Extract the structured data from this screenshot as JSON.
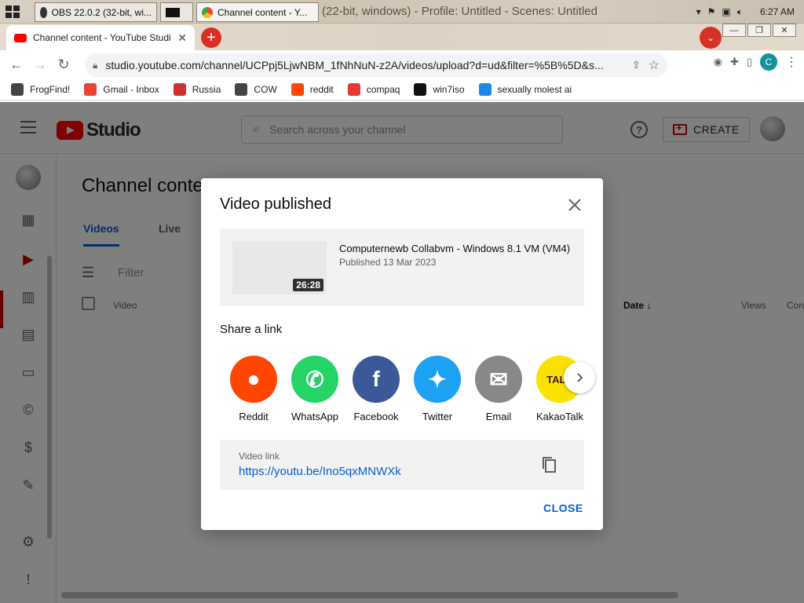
{
  "taskbar": {
    "window_title": "Channel content - YouTube Studio - Google Chrome",
    "obs_title": "OBS 22.0.2 (32-bit, windows) - Profile: Untitled - Scenes: Untitled",
    "obs_button": "OBS 22.0.2 (32-bit, wi...",
    "cmd_button": "",
    "chrome_button": "Channel content - Y...",
    "obs_title_behind": "(22-bit, windows) - Profile: Untitled - Scenes: Untitled",
    "clock": "6:27 AM"
  },
  "chrome": {
    "tab_title": "Channel content - YouTube Studi",
    "url": "studio.youtube.com/channel/UCPpj5LjwNBM_1fNhNuN-z2A/videos/upload?d=ud&filter=%5B%5D&s...",
    "profile_letter": "C"
  },
  "bookmarks": [
    {
      "label": "FrogFind!",
      "color": "#444"
    },
    {
      "label": "Gmail - Inbox",
      "color": "#ea4335"
    },
    {
      "label": "Russia",
      "color": "#d32f2f"
    },
    {
      "label": "COW",
      "color": "#444"
    },
    {
      "label": "reddit",
      "color": "#ff4500"
    },
    {
      "label": "compaq",
      "color": "#e53935"
    },
    {
      "label": "win7iso",
      "color": "#111"
    },
    {
      "label": "sexually molest ai",
      "color": "#1e88e5"
    }
  ],
  "studio": {
    "logo_text": "Studio",
    "search_placeholder": "Search across your channel",
    "create_label": "CREATE",
    "page_title": "Channel content",
    "tabs": [
      "Videos",
      "Live"
    ],
    "filter_placeholder": "Filter",
    "columns": {
      "video": "Video",
      "date": "Date",
      "views": "Views",
      "comments": "Con"
    }
  },
  "dialog": {
    "title": "Video published",
    "video_title": "Computernewb Collabvm - Windows 8.1 VM (VM4)",
    "published": "Published 13 Mar 2023",
    "duration": "26:28",
    "share_heading": "Share a link",
    "share_targets": [
      {
        "label": "Reddit",
        "color": "#ff4500"
      },
      {
        "label": "WhatsApp",
        "color": "#25d366"
      },
      {
        "label": "Facebook",
        "color": "#3b5998"
      },
      {
        "label": "Twitter",
        "color": "#1da1f2"
      },
      {
        "label": "Email",
        "color": "#888888"
      },
      {
        "label": "KakaoTalk",
        "color": "#fae100"
      }
    ],
    "link_label": "Video link",
    "link_url": "https://youtu.be/Ino5qxMNWXk",
    "close_label": "CLOSE"
  }
}
